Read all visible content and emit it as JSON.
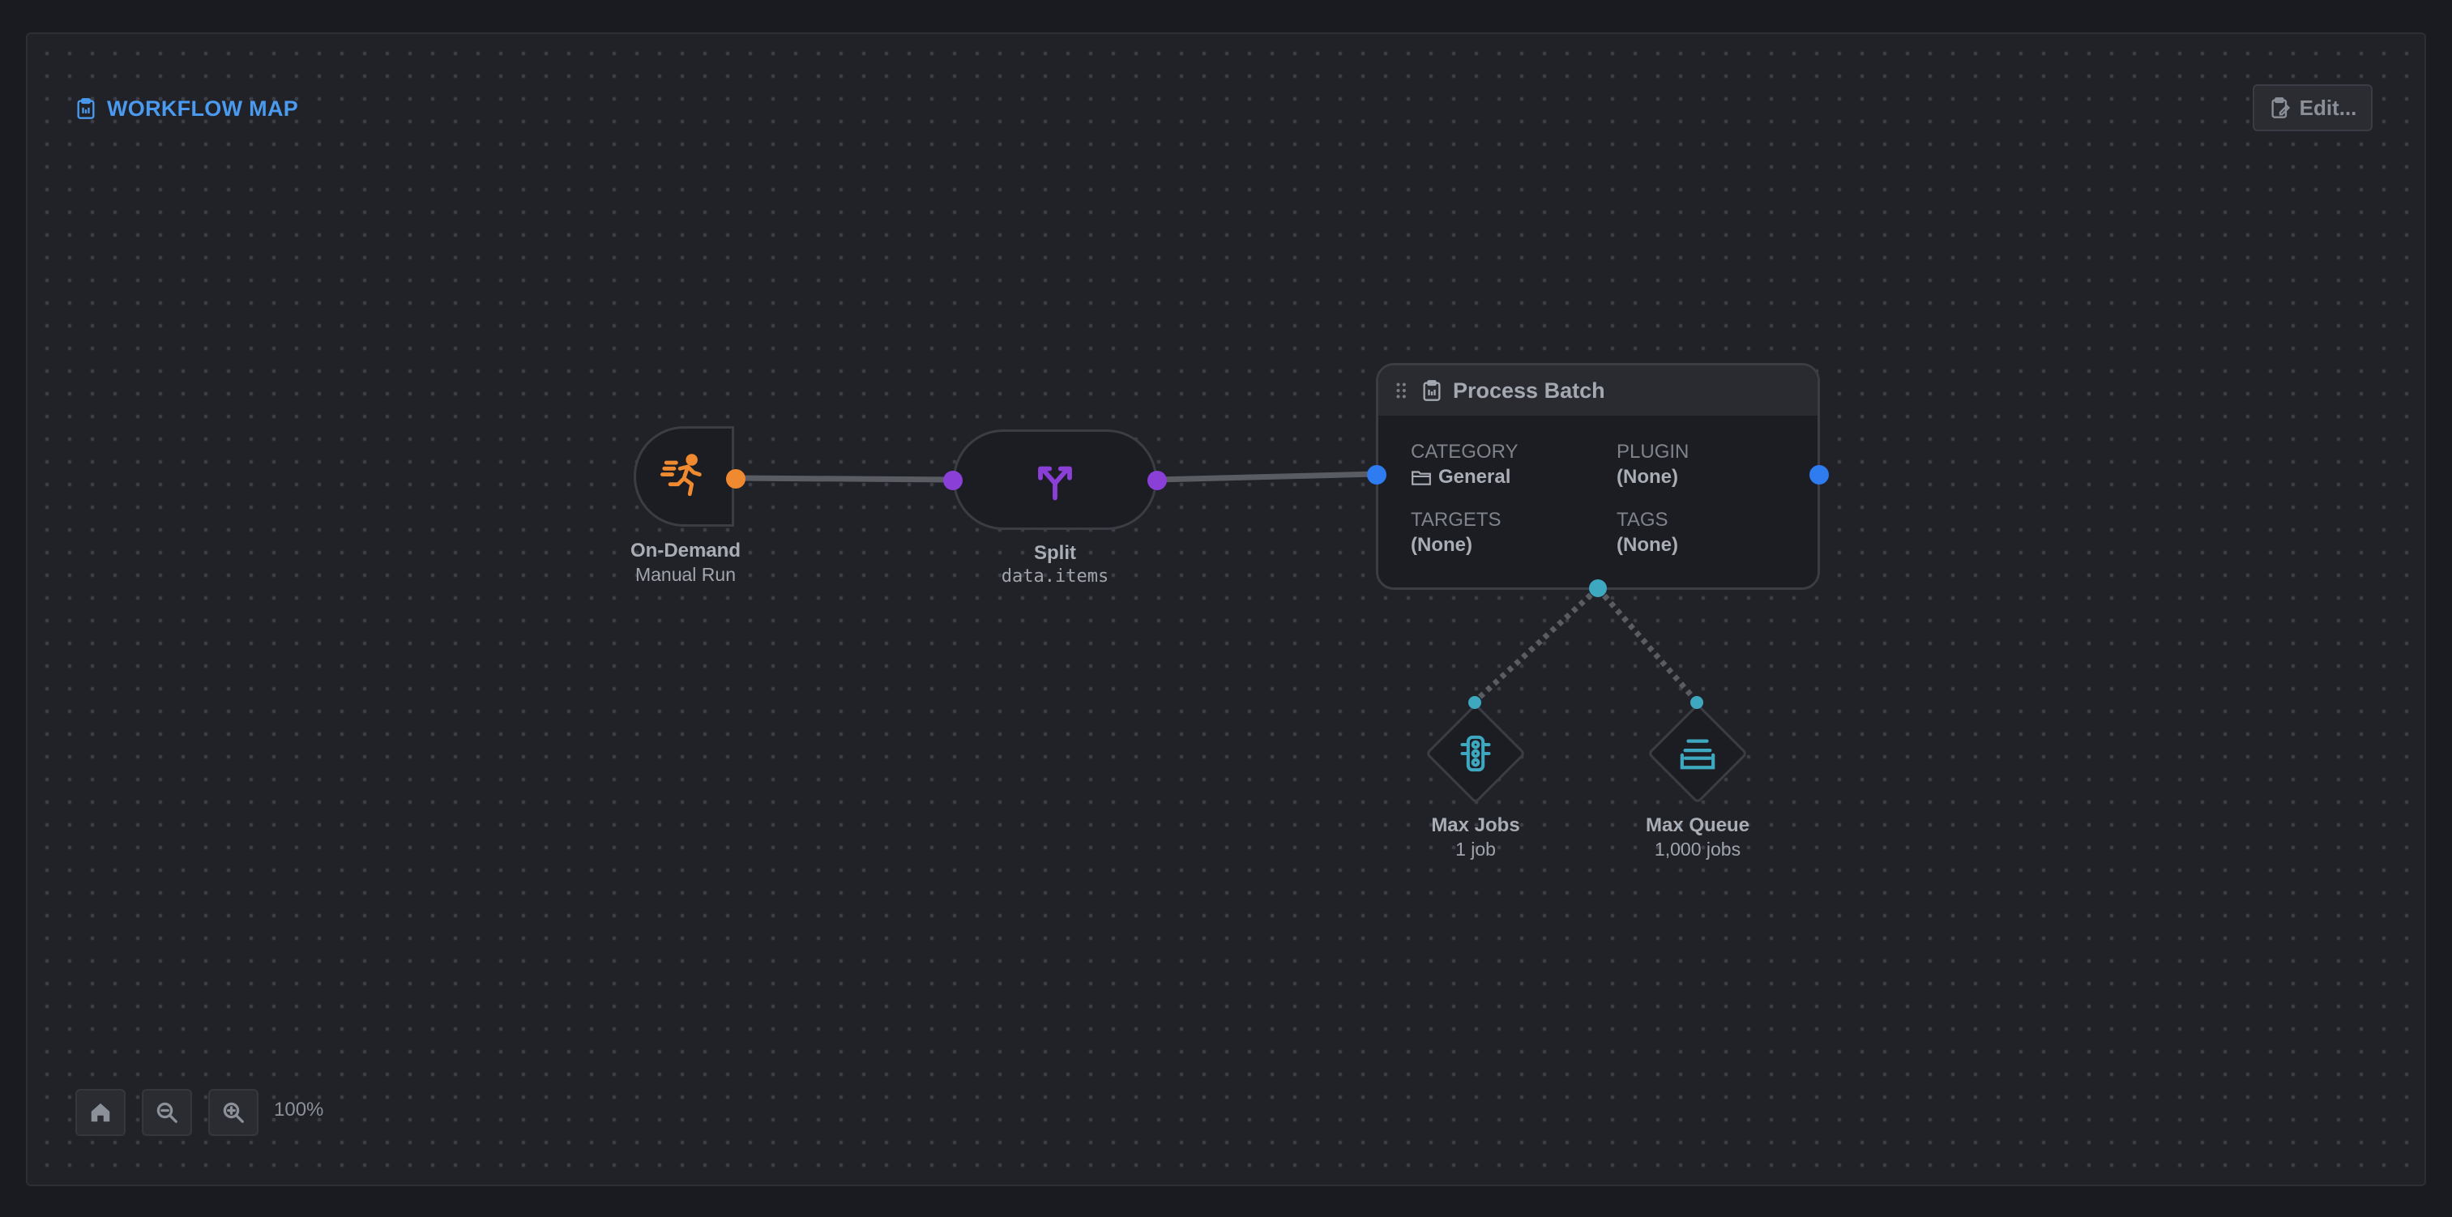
{
  "header": {
    "title": "WORKFLOW MAP",
    "edit_label": "Edit..."
  },
  "colors": {
    "accent": "#4a9af0",
    "trigger": "#f08a30",
    "split": "#8a3fd6",
    "batch": "#2f7bf0",
    "limit": "#3ea8c0"
  },
  "nodes": {
    "trigger": {
      "icon": "running-person-icon",
      "title": "On-Demand",
      "subtitle": "Manual Run"
    },
    "split": {
      "icon": "split-arrows-icon",
      "title": "Split",
      "subtitle": "data.items"
    },
    "batch": {
      "icon": "clipboard-icon",
      "title": "Process Batch",
      "fields": [
        {
          "key": "CATEGORY",
          "value": "General",
          "icon": "folder-icon"
        },
        {
          "key": "PLUGIN",
          "value": "(None)"
        },
        {
          "key": "TARGETS",
          "value": "(None)"
        },
        {
          "key": "TAGS",
          "value": "(None)"
        }
      ]
    },
    "limits": [
      {
        "icon": "traffic-light-icon",
        "title": "Max Jobs",
        "subtitle": "1 job"
      },
      {
        "icon": "queue-icon",
        "title": "Max Queue",
        "subtitle": "1,000 jobs"
      }
    ]
  },
  "controls": {
    "zoom_level": "100%",
    "buttons": [
      "home-icon",
      "zoom-out-icon",
      "zoom-in-icon"
    ]
  }
}
